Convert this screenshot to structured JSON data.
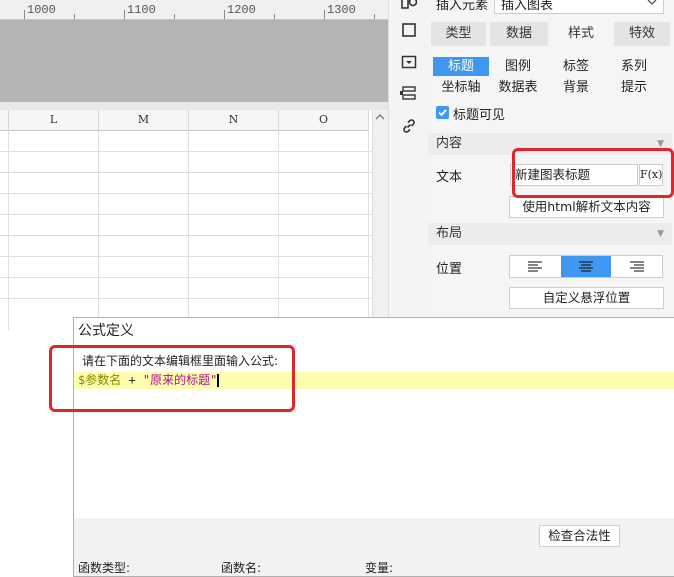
{
  "ruler": {
    "labels": [
      "1000",
      "1100",
      "1200",
      "1300"
    ]
  },
  "sheet": {
    "columns": [
      "L",
      "M",
      "N",
      "O"
    ],
    "scroll_up": "^"
  },
  "panel": {
    "insert_element_label": "插入元素",
    "insert_chart_label": "插入图表",
    "tabs": [
      "类型",
      "数据",
      "样式",
      "特效"
    ],
    "subtabs_row1": [
      "标题",
      "图例",
      "标签",
      "系列"
    ],
    "subtabs_row2": [
      "坐标轴",
      "数据表",
      "背景",
      "提示"
    ],
    "title_visible_label": "标题可见",
    "content_section": "内容",
    "text_label": "文本",
    "text_value": "新建图表标题",
    "fx_label": "F(x)",
    "html_parse_button": "使用html解析文本内容",
    "layout_section": "布局",
    "position_label": "位置",
    "custom_float_button": "自定义悬浮位置"
  },
  "dialog": {
    "title": "公式定义",
    "instruction": "请在下面的文本编辑框里面输入公式:",
    "formula_param": "$参数名",
    "formula_op": " + ",
    "formula_string": "\"原来的标题\"",
    "check_button": "检查合法性",
    "footer_labels": [
      "函数类型:",
      "函数名:",
      "变量:"
    ]
  },
  "colors": {
    "accent": "#3e97f0",
    "highlight": "#e0262b",
    "formula_bg": "#fefcae"
  }
}
